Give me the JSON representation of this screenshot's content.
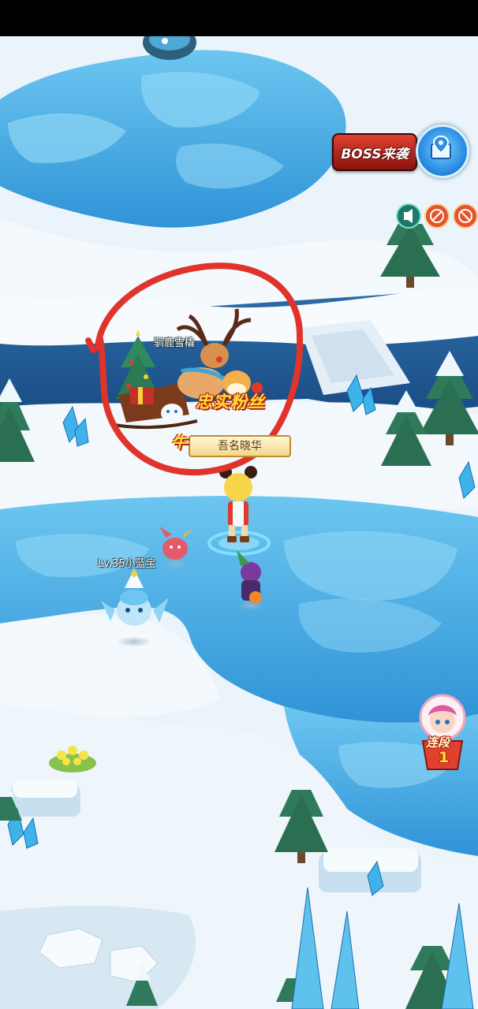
{
  "game": {
    "mount_name": "驯鹿雪橇",
    "title_banner": "忠实粉丝",
    "player_name": "吾名晓华",
    "title_prefix_glyph": "牛",
    "pet_label": "Lv.35小蓝宝",
    "boss_event": "BOSS来袭",
    "combo_label": "连段",
    "combo_count": "1"
  },
  "icons": {
    "map": "map-pin-icon",
    "voice": "voice-icon",
    "mute_a": "mute-icon",
    "mute_b": "no-music-icon",
    "combo": "character-portrait-icon"
  },
  "colors": {
    "annotation_circle": "#e0332c",
    "snow": "#f2f8fc",
    "ice": "#4fb3e8",
    "boss_badge": "#c92a1e"
  }
}
